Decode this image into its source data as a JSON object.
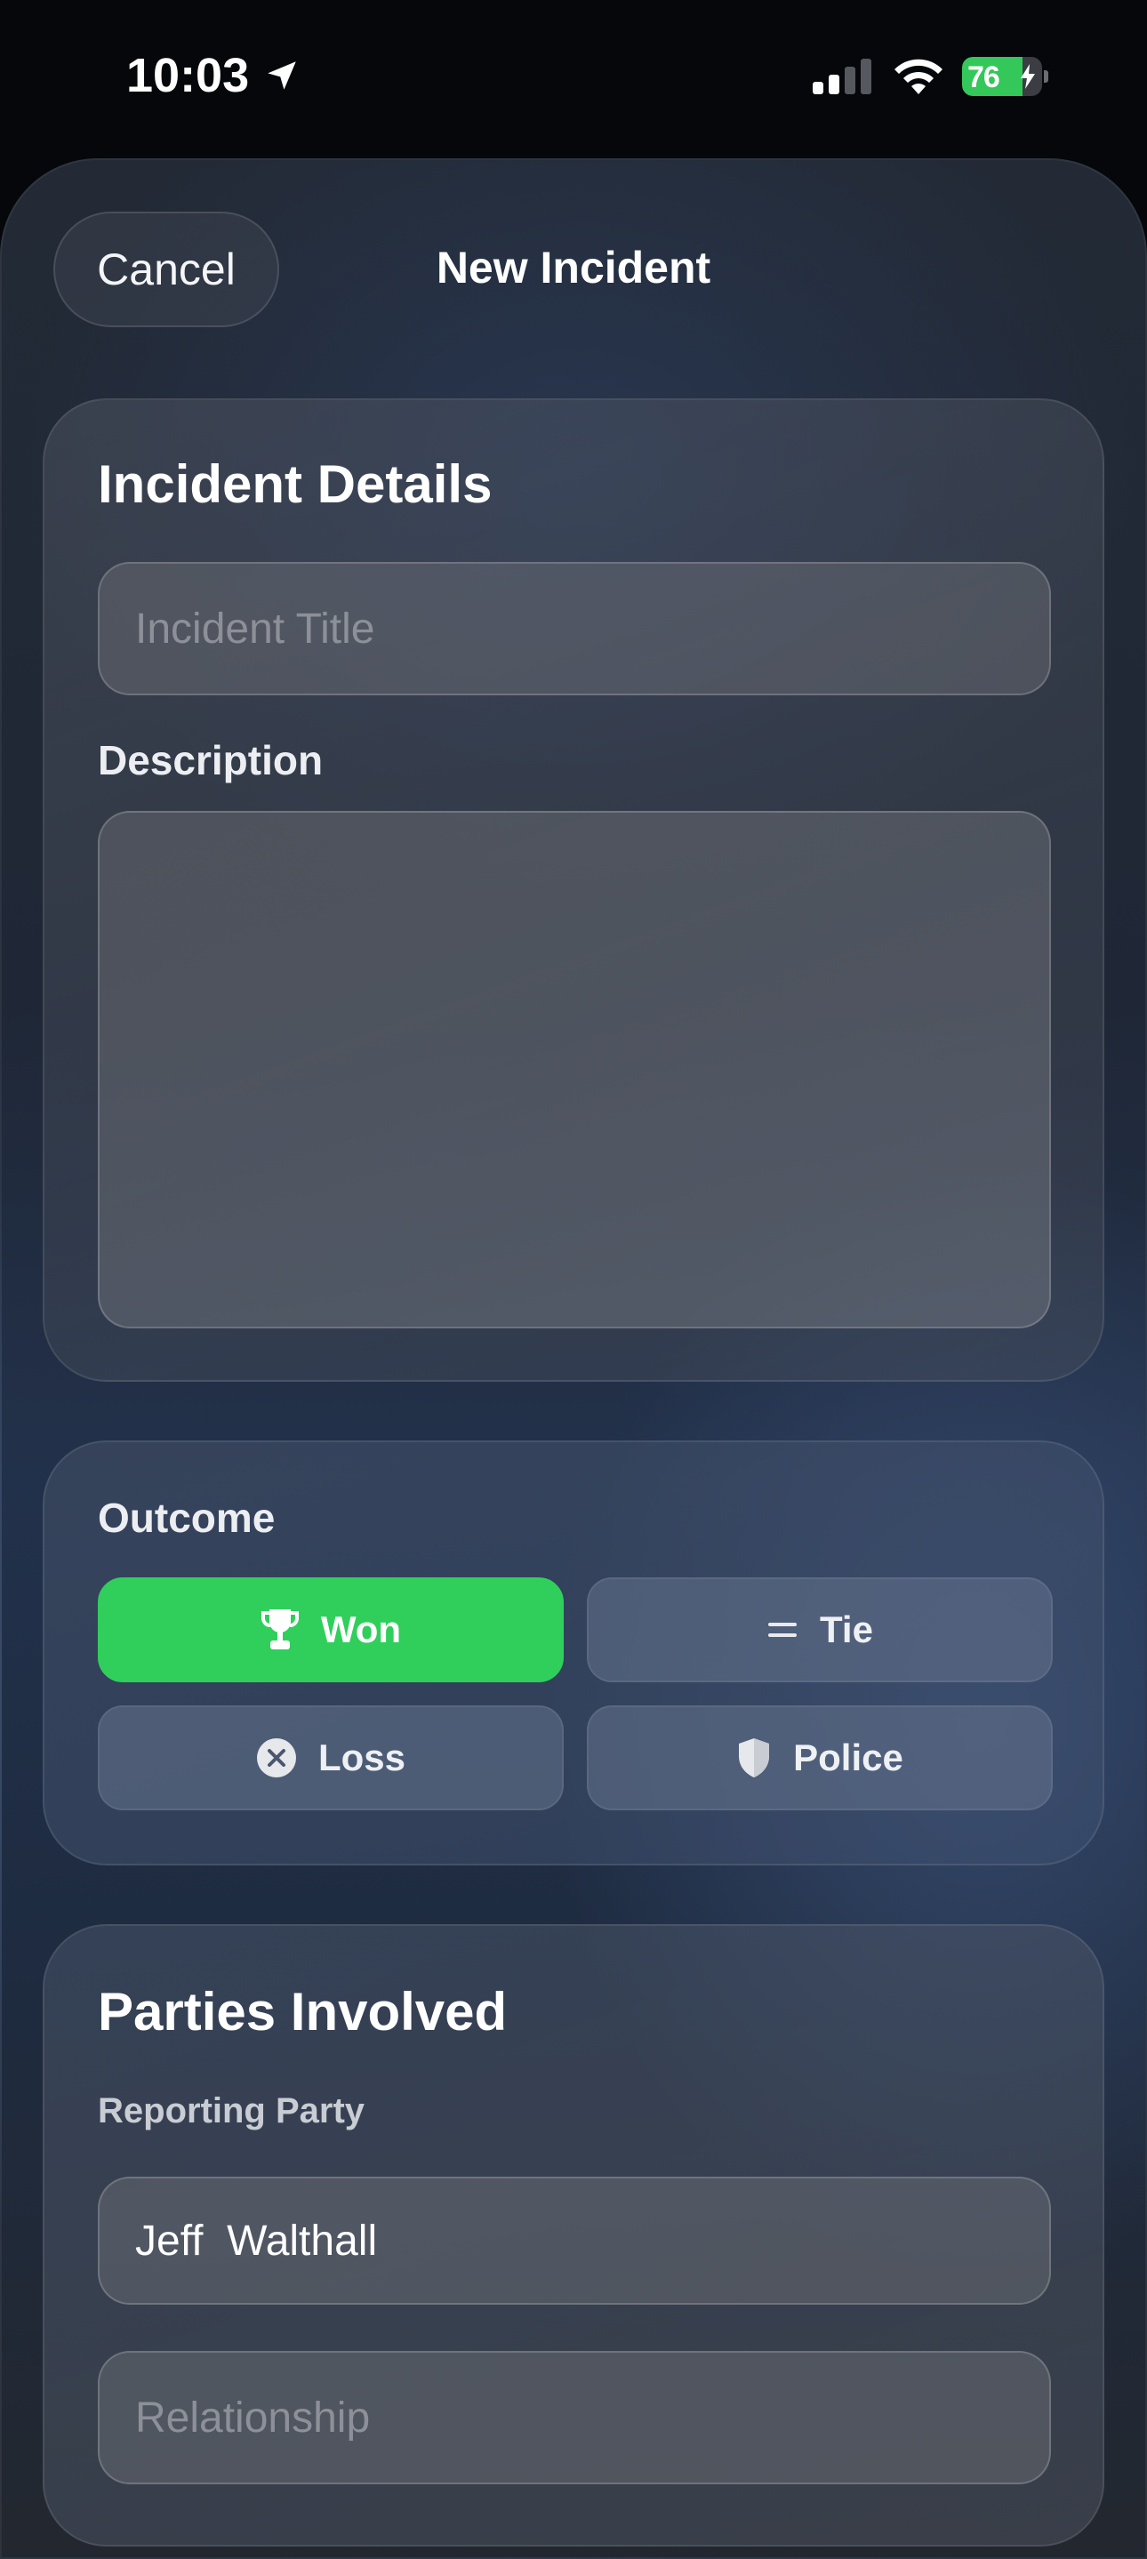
{
  "status_bar": {
    "time": "10:03",
    "battery_percent": "76",
    "battery_level": 0.76
  },
  "nav": {
    "cancel_label": "Cancel",
    "title": "New Incident"
  },
  "incident_details": {
    "section_title": "Incident Details",
    "title_placeholder": "Incident Title",
    "title_value": "",
    "description_label": "Description",
    "description_value": ""
  },
  "outcome": {
    "label": "Outcome",
    "selected": "Won",
    "options": [
      {
        "label": "Won",
        "icon": "trophy-icon"
      },
      {
        "label": "Tie",
        "icon": "equals-icon"
      },
      {
        "label": "Loss",
        "icon": "x-circle-icon"
      },
      {
        "label": "Police",
        "icon": "shield-icon"
      }
    ]
  },
  "parties": {
    "section_title": "Parties Involved",
    "reporting_party_label": "Reporting Party",
    "reporting_party_value": "Jeff  Walthall",
    "relationship_placeholder": "Relationship",
    "relationship_value": ""
  },
  "colors": {
    "accent_green": "#30cf5c",
    "battery_green": "#34c759"
  }
}
